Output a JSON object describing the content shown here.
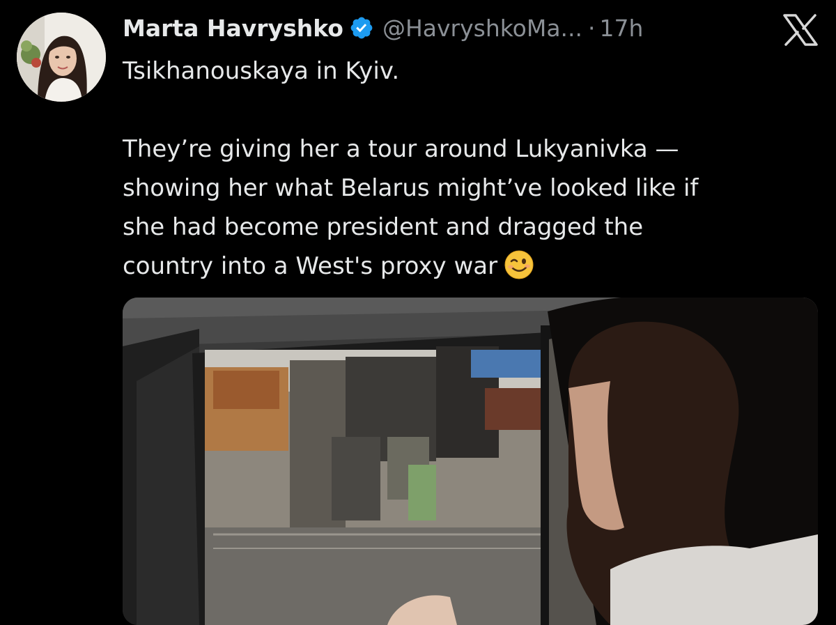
{
  "tweet": {
    "author": {
      "display_name": "Marta Havryshko",
      "handle": "@HavryshkoMa...",
      "verified": true,
      "avatar_icon": "avatar-photo"
    },
    "timestamp": "17h",
    "separator": "·",
    "text_lines": [
      "Tsikhanouskaya in Kyiv.",
      "They’re giving her a tour around Lukyanivka —",
      "showing her what Belarus might’ve looked like if",
      "she had become president and dragged the",
      "country into a West's proxy war"
    ],
    "emoji": "winking-face-emoji",
    "media": {
      "type": "video-still",
      "description_icon": "car-window-view-image"
    }
  },
  "brand": {
    "logo_icon": "x-logo-icon"
  },
  "colors": {
    "background": "#000000",
    "primary_text": "#e7e9ea",
    "secondary_text": "#8b9096",
    "verified_blue": "#1d9bf0"
  }
}
